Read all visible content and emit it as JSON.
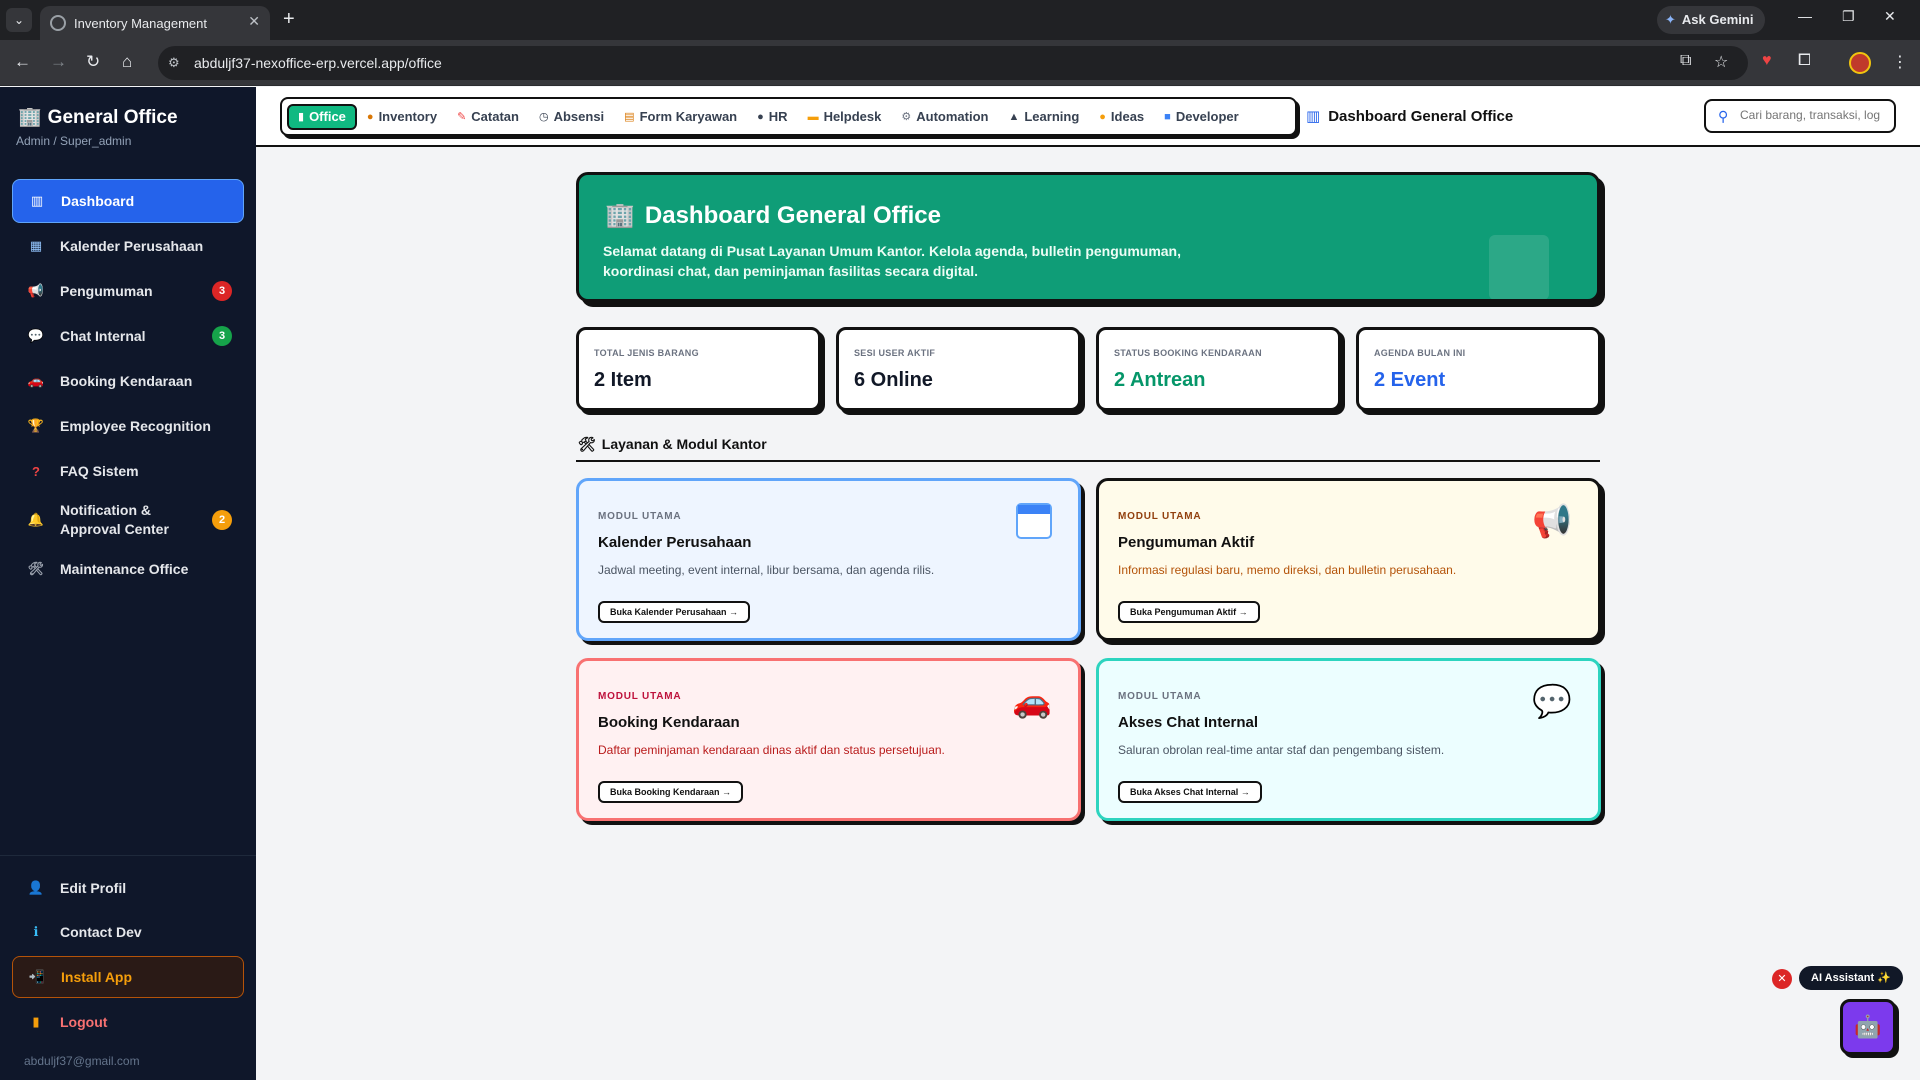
{
  "browser": {
    "tab_title": "Inventory Management",
    "tab_close": "✕",
    "new_tab": "+",
    "url": "abduljf37-nexoffice-erp.vercel.app/office",
    "gemini_label": "Ask Gemini"
  },
  "sidebar": {
    "brand": "General Office",
    "role": "Admin / Super_admin",
    "items": [
      {
        "label": "Dashboard",
        "icon": "chart-icon"
      },
      {
        "label": "Kalender Perusahaan",
        "icon": "calendar-icon"
      },
      {
        "label": "Pengumuman",
        "icon": "megaphone-icon",
        "badge": "3"
      },
      {
        "label": "Chat Internal",
        "icon": "chat-icon",
        "badge": "3"
      },
      {
        "label": "Booking Kendaraan",
        "icon": "car-icon"
      },
      {
        "label": "Employee Recognition",
        "icon": "trophy-icon"
      },
      {
        "label": "FAQ Sistem",
        "icon": "question-icon"
      },
      {
        "label": "Notification & Approval Center",
        "icon": "bell-icon",
        "badge": "2"
      },
      {
        "label": "Maintenance Office",
        "icon": "tools-icon"
      }
    ],
    "bottom": {
      "edit_profile": "Edit Profil",
      "contact_dev": "Contact Dev",
      "install_app": "Install App",
      "logout": "Logout",
      "email": "abduljf37@gmail.com"
    },
    "colors": {
      "active": "#2563eb",
      "badge_red": "#dc2626",
      "badge_green": "#16a34a",
      "badge_orange": "#f59e0b"
    }
  },
  "topnav": {
    "items": [
      {
        "label": "Office",
        "icon": "office-icon"
      },
      {
        "label": "Inventory",
        "icon": "box-icon"
      },
      {
        "label": "Catatan",
        "icon": "note-icon"
      },
      {
        "label": "Absensi",
        "icon": "clock-icon"
      },
      {
        "label": "Form Karyawan",
        "icon": "form-icon"
      },
      {
        "label": "HR",
        "icon": "person-icon"
      },
      {
        "label": "Helpdesk",
        "icon": "ticket-icon"
      },
      {
        "label": "Automation",
        "icon": "gear-icon"
      },
      {
        "label": "Learning",
        "icon": "graduation-icon"
      },
      {
        "label": "Ideas",
        "icon": "bulb-icon"
      },
      {
        "label": "Developer",
        "icon": "code-icon"
      }
    ],
    "page_title": "Dashboard General Office",
    "search_placeholder": "Cari barang, transaksi, log"
  },
  "hero": {
    "title": "Dashboard General Office",
    "description": "Selamat datang di Pusat Layanan Umum Kantor. Kelola agenda, bulletin pengumuman, koordinasi chat, dan peminjaman fasilitas secara digital.",
    "color": "#0f9d77"
  },
  "stats": [
    {
      "label": "TOTAL JENIS BARANG",
      "value": "2 Item",
      "color": "#111827"
    },
    {
      "label": "SESI USER AKTIF",
      "value": "6 Online",
      "color": "#111827"
    },
    {
      "label": "STATUS BOOKING KENDARAAN",
      "value": "2 Antrean",
      "color": "#059669"
    },
    {
      "label": "AGENDA BULAN INI",
      "value": "2 Event",
      "color": "#2563eb"
    }
  ],
  "section_title": "Layanan & Modul Kantor",
  "modules": [
    {
      "kicker": "MODUL UTAMA",
      "title": "Kalender Perusahaan",
      "desc": "Jadwal meeting, event internal, libur bersama, dan agenda rilis.",
      "button": "Buka Kalender Perusahaan →",
      "bg": "#eef5ff",
      "border": "#60a5fa",
      "desc_color": "#4b5563"
    },
    {
      "kicker": "MODUL UTAMA",
      "title": "Pengumuman Aktif",
      "desc": "Informasi regulasi baru, memo direksi, dan bulletin perusahaan.",
      "button": "Buka Pengumuman Aktif →",
      "bg": "#fffbea",
      "border": "#111111",
      "desc_color": "#b45309"
    },
    {
      "kicker": "MODUL UTAMA",
      "title": "Booking Kendaraan",
      "desc": "Daftar peminjaman kendaraan dinas aktif dan status persetujuan.",
      "button": "Buka Booking Kendaraan →",
      "bg": "#fff1f2",
      "border": "#f87171",
      "desc_color": "#b91c1c"
    },
    {
      "kicker": "MODUL UTAMA",
      "title": "Akses Chat Internal",
      "desc": "Saluran obrolan real-time antar staf dan pengembang sistem.",
      "button": "Buka Akses Chat Internal →",
      "bg": "#ecfeff",
      "border": "#2dd4bf",
      "desc_color": "#4b5563"
    }
  ],
  "ai": {
    "label": "AI Assistant ✨",
    "close": "✕"
  }
}
